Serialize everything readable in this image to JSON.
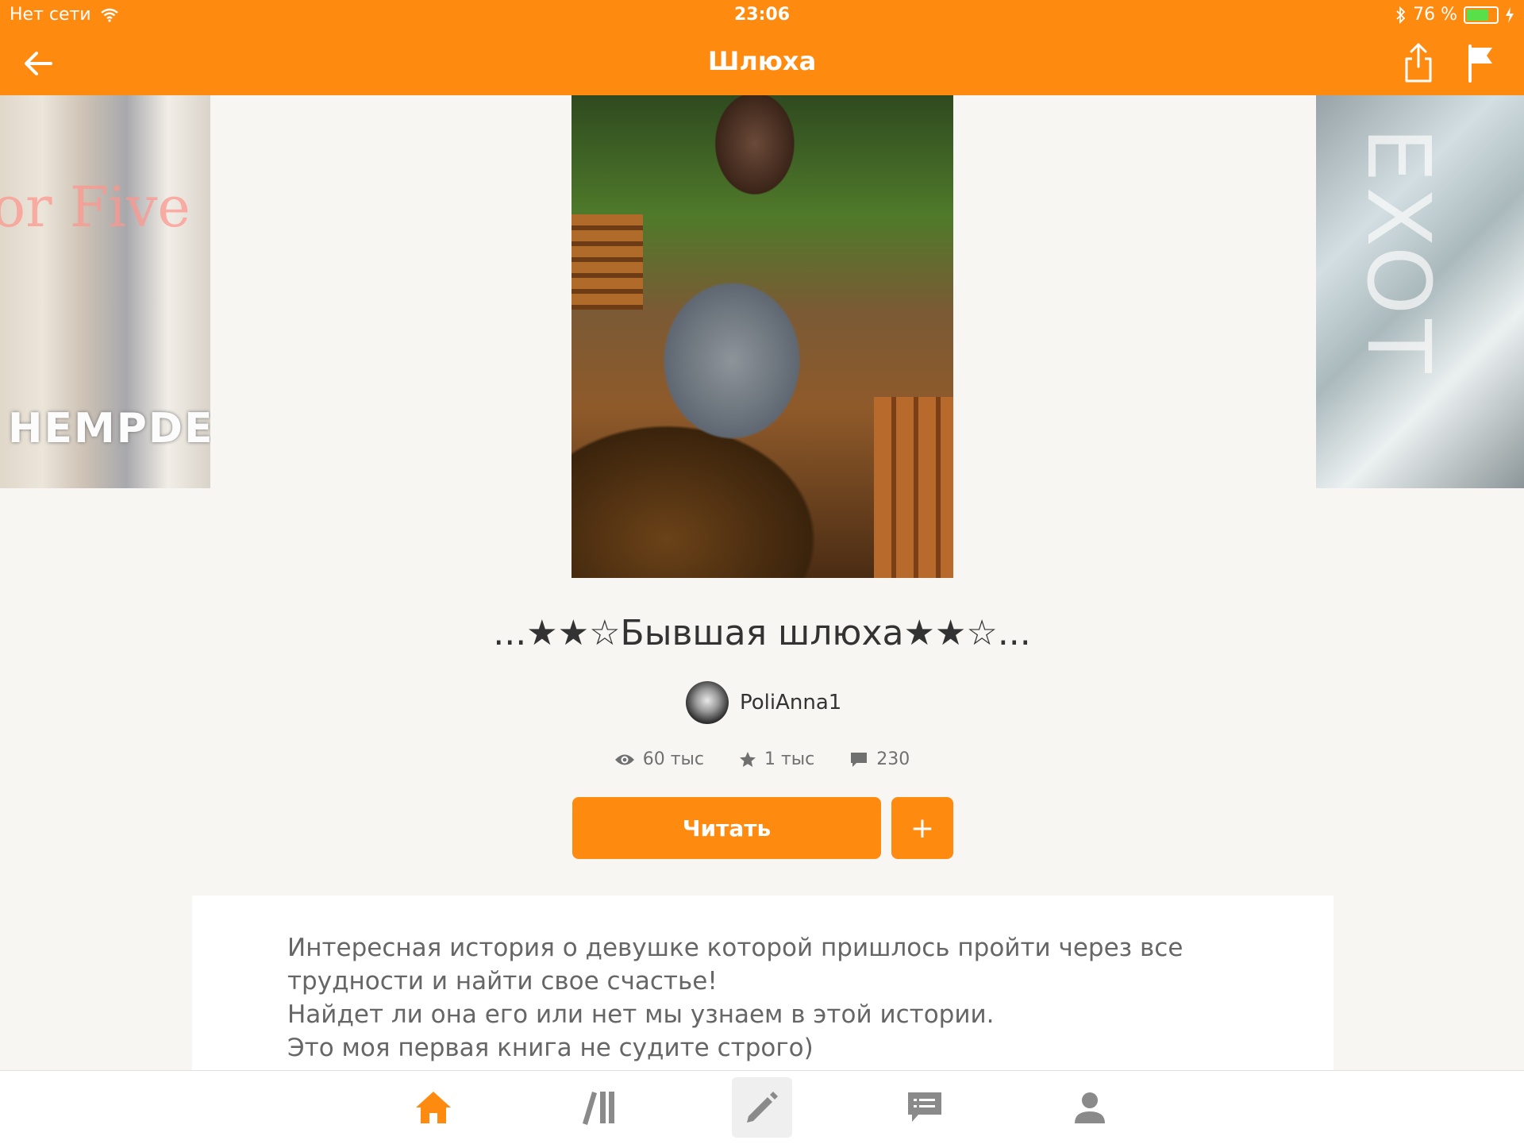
{
  "status_bar": {
    "carrier": "Нет сети",
    "time": "23:06",
    "battery": "76 %",
    "battery_level": 0.76,
    "icons": [
      "wifi-icon",
      "bluetooth-icon",
      "battery-icon",
      "charging-icon"
    ]
  },
  "nav": {
    "title": "Шлюха",
    "icons": [
      "back-arrow-icon",
      "share-icon",
      "flag-icon"
    ]
  },
  "covers": {
    "left_script": "or Five",
    "left_bottom": "HEMPDE",
    "right_text": "EXOT"
  },
  "book": {
    "title": "...★★☆Бывшая шлюха★★☆...",
    "author": "PoliAnna1",
    "stats": {
      "views": "60 тыс",
      "votes": "1 тыс",
      "comments": "230"
    },
    "read_button": "Читать",
    "add_button": "+",
    "description": [
      "Интересная история о девушке которой пришлось пройти через все",
      "трудности и найти свое счастье!",
      "Найдет ли она его или нет мы узнаем в этой истории.",
      "Это моя первая книга не судите строго)"
    ]
  },
  "tabs": [
    "home-icon",
    "library-icon",
    "write-icon",
    "messages-icon",
    "profile-icon"
  ],
  "colors": {
    "accent": "#ff8a10",
    "background": "#f8f6f3",
    "text": "#333333"
  }
}
